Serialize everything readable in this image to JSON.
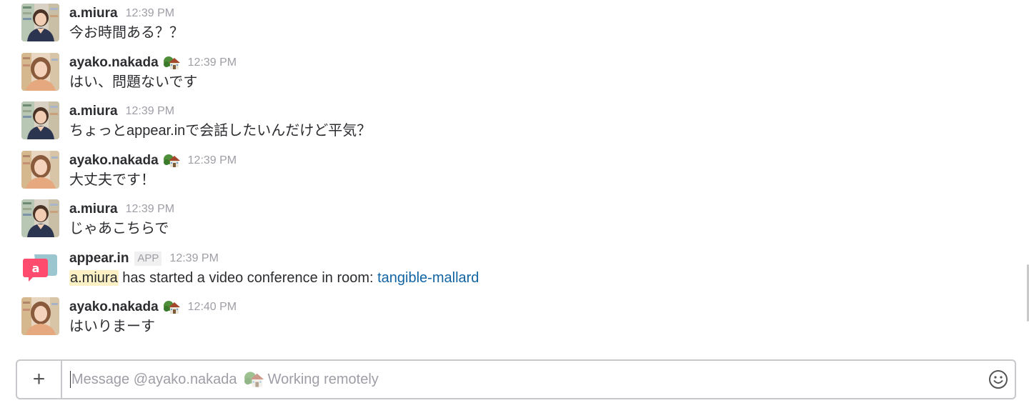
{
  "messages": [
    {
      "author": "a.miura",
      "time": "12:39 PM",
      "text": "今お時間ある？？",
      "avatar": "avatar-miura"
    },
    {
      "author": "ayako.nakada",
      "time": "12:39 PM",
      "text": "はい、問題ないです",
      "avatar": "avatar-nakada",
      "status_icon": "house-with-garden-icon"
    },
    {
      "author": "a.miura",
      "time": "12:39 PM",
      "text": "ちょっとappear.inで会話したいんだけど平気？",
      "avatar": "avatar-miura"
    },
    {
      "author": "ayako.nakada",
      "time": "12:39 PM",
      "text": "大丈夫です！",
      "avatar": "avatar-nakada",
      "status_icon": "house-with-garden-icon"
    },
    {
      "author": "a.miura",
      "time": "12:39 PM",
      "text": "じゃあこちらで",
      "avatar": "avatar-miura"
    },
    {
      "author": "appear.in",
      "badge": "APP",
      "time": "12:39 PM",
      "avatar": "appear-in-logo",
      "mention": "a.miura",
      "text_middle": " has started a video conference in room: ",
      "link": "tangible-mallard"
    },
    {
      "author": "ayako.nakada",
      "time": "12:40 PM",
      "text": "はいりまーす",
      "avatar": "avatar-nakada",
      "status_icon": "house-with-garden-icon"
    }
  ],
  "composer": {
    "add_label": "+",
    "placeholder_prefix": "Message @ayako.nakada",
    "placeholder_suffix": "Working remotely",
    "status_icon": "house-with-garden-icon",
    "emoji_icon": "smiley-icon"
  },
  "colors": {
    "link": "#1264a3",
    "mention_bg": "#fbf1c4",
    "timestamp": "#9e9ea6",
    "appear_in_brand": "#ff4b6e"
  }
}
